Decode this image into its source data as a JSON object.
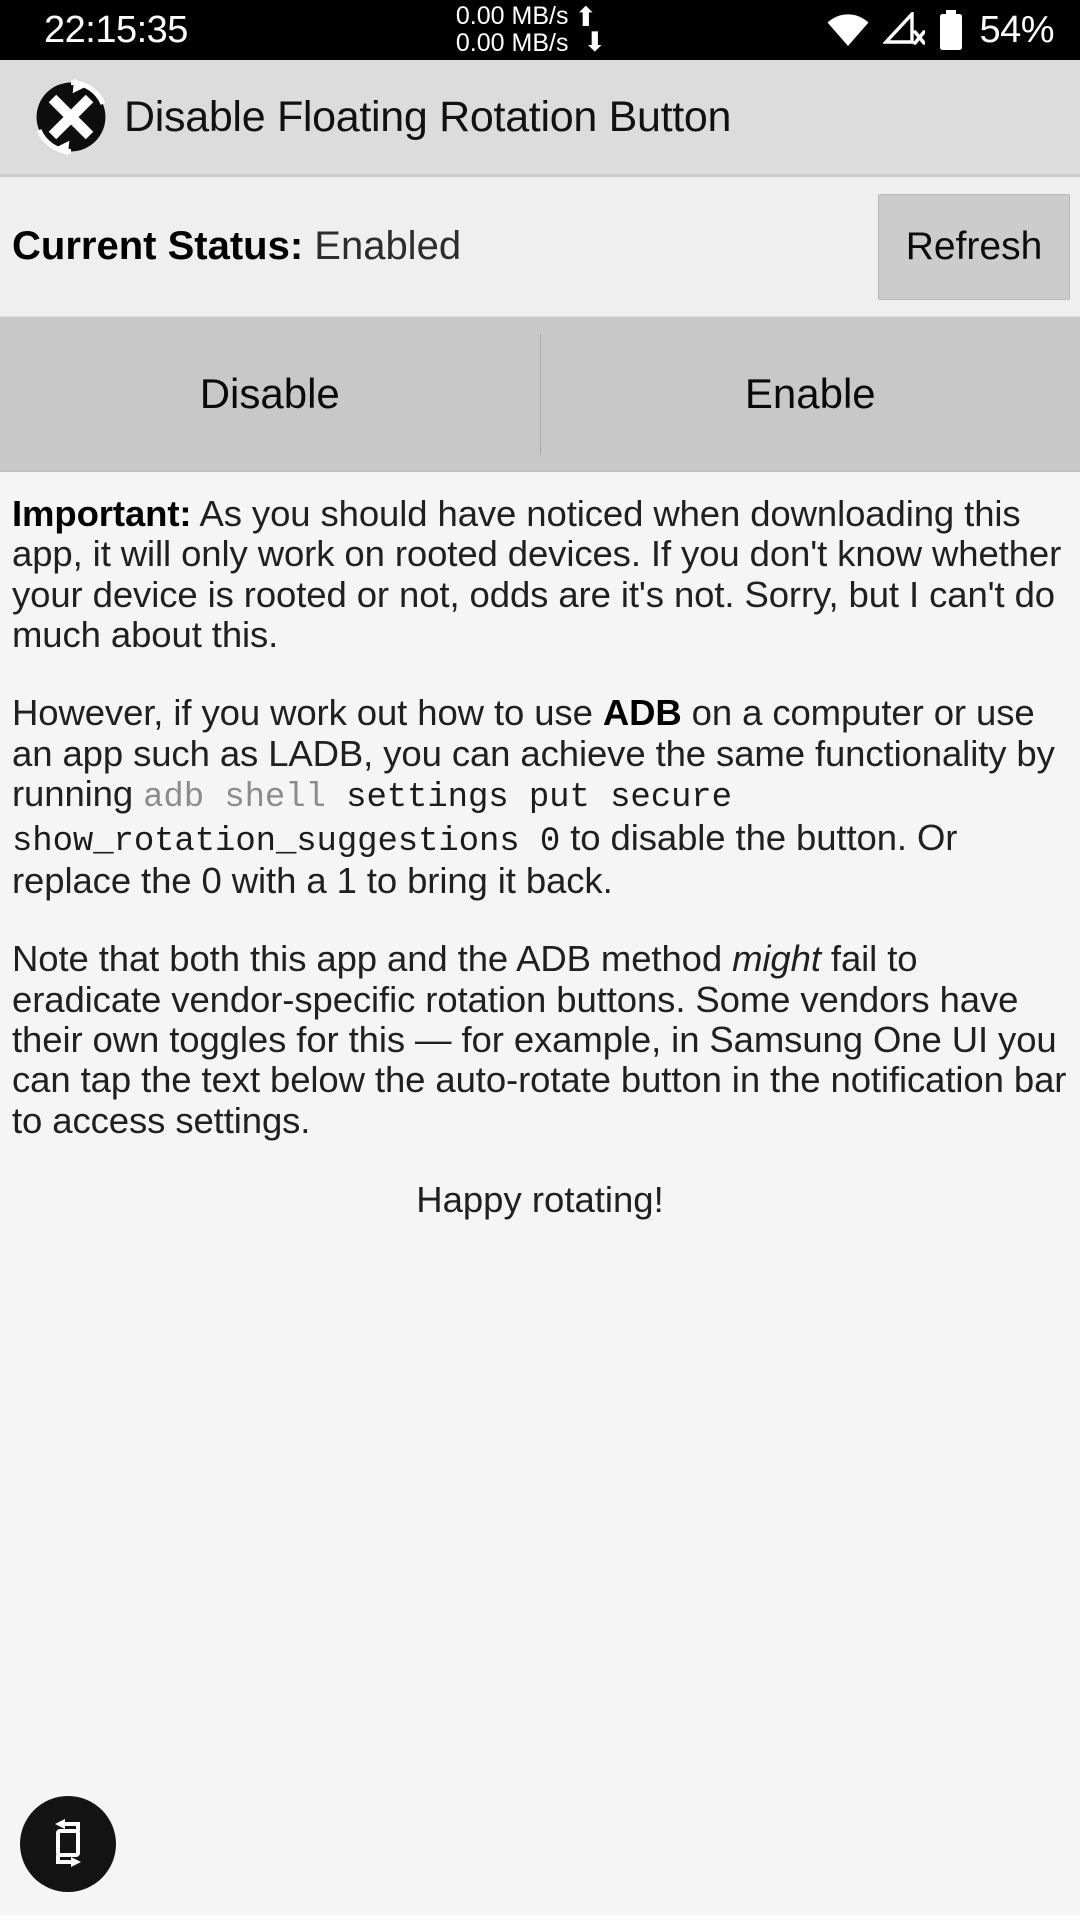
{
  "status_bar": {
    "clock": "22:15:35",
    "net_up": "0.00 MB/s",
    "net_down": "0.00 MB/s",
    "up_arrow_icon": "arrow-up-icon",
    "down_arrow_icon": "arrow-down-icon",
    "wifi_icon": "wifi-icon",
    "cellular_icon": "cellular-no-signal-icon",
    "battery_icon": "battery-icon",
    "battery_percent": "54%"
  },
  "app_bar": {
    "icon": "disable-rotation-app-icon",
    "title": "Disable Floating Rotation Button"
  },
  "status_row": {
    "label": "Current Status:",
    "value": "Enabled",
    "refresh_label": "Refresh"
  },
  "toggles": {
    "disable_label": "Disable",
    "enable_label": "Enable"
  },
  "body": {
    "p1_bold": "Important:",
    "p1_rest": " As you should have noticed when downloading this app, it will only work on rooted devices. If you don't know whether your device is rooted or not, odds are it's not. Sorry, but I can't do much about this.",
    "p2_a": "However, if you work out how to use ",
    "p2_bold": "ADB",
    "p2_b": " on a computer or use an app such as LADB, you can achieve the same functionality by running ",
    "p2_cmd_dim": "adb shell",
    "p2_cmd": " settings put secure show_rotation_suggestions 0",
    "p2_c": " to disable the button. Or replace the 0 with a 1 to bring it back.",
    "p3_a": "Note that both this app and the ADB method ",
    "p3_italic": "might",
    "p3_b": " fail to eradicate vendor-specific rotation buttons. Some vendors have their own toggles for this — for example, in Samsung One UI you can tap the text below the auto-rotate button in the notification bar to access settings.",
    "closing": "Happy rotating!"
  },
  "fab": {
    "icon": "rotate-device-icon"
  },
  "colors": {
    "status_bar_bg": "#000000",
    "app_bar_bg": "#dcdcdc",
    "status_row_bg": "#efefef",
    "toggle_row_bg": "#c8c8c8",
    "content_bg": "#f5f5f5",
    "fab_bg": "#141414",
    "mono_dim": "#8c8c8c"
  }
}
